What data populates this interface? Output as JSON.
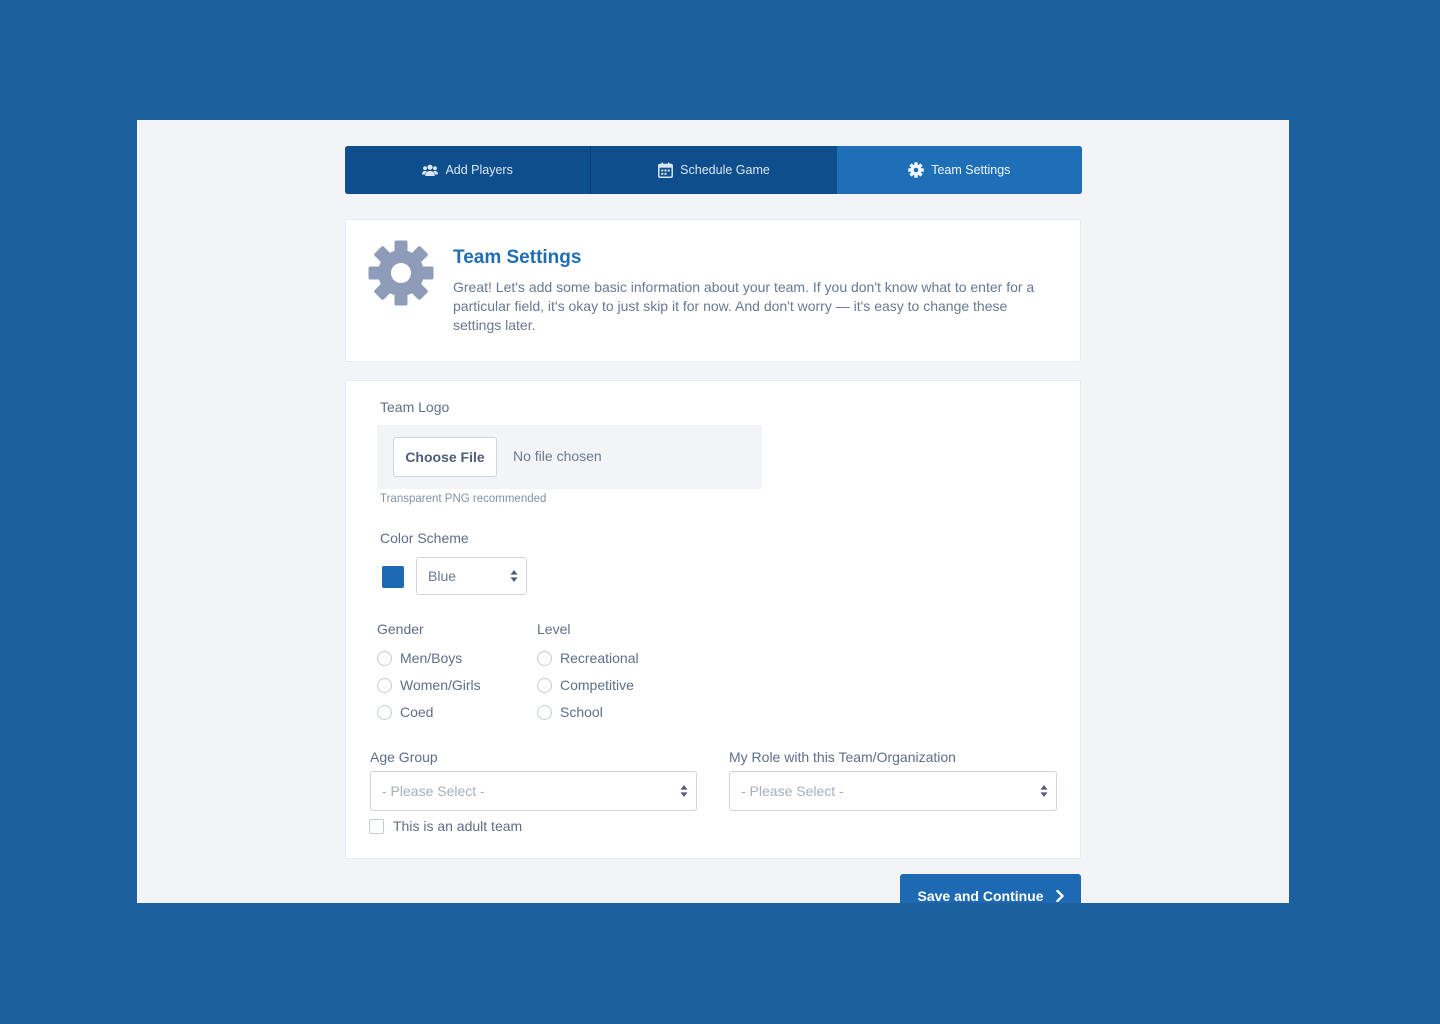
{
  "tabs": [
    {
      "label": "Add Players",
      "icon": "users-icon",
      "active": false
    },
    {
      "label": "Schedule Game",
      "icon": "calendar-icon",
      "active": false
    },
    {
      "label": "Team Settings",
      "icon": "gear-icon",
      "active": true
    }
  ],
  "intro": {
    "icon": "gear-icon",
    "title": "Team Settings",
    "body": "Great! Let's add some basic information about your team. If you don't know what to enter for a particular field, it's okay to just skip it for now. And don't worry — it's easy to change these settings later."
  },
  "form": {
    "team_logo": {
      "label": "Team Logo",
      "button_label": "Choose File",
      "status": "No file chosen",
      "hint": "Transparent PNG recommended"
    },
    "color_scheme": {
      "label": "Color Scheme",
      "swatch_color": "#1d6ab2",
      "selected": "Blue"
    },
    "gender": {
      "label": "Gender",
      "options": [
        "Men/Boys",
        "Women/Girls",
        "Coed"
      ]
    },
    "level": {
      "label": "Level",
      "options": [
        "Recreational",
        "Competitive",
        "School"
      ]
    },
    "age_group": {
      "label": "Age Group",
      "placeholder": "- Please Select -"
    },
    "role": {
      "label": "My Role with this Team/Organization",
      "placeholder": "- Please Select -"
    },
    "adult_team": {
      "label": "This is an adult team",
      "checked": false
    }
  },
  "save_button": {
    "label": "Save and Continue",
    "icon": "chevron-right-icon"
  },
  "colors": {
    "background": "#1c619e",
    "tab_bar": "#0f4e8c",
    "tab_active": "#1f6fb8",
    "accent": "#1d6ab2",
    "gear_icon": "#8e9cba"
  }
}
